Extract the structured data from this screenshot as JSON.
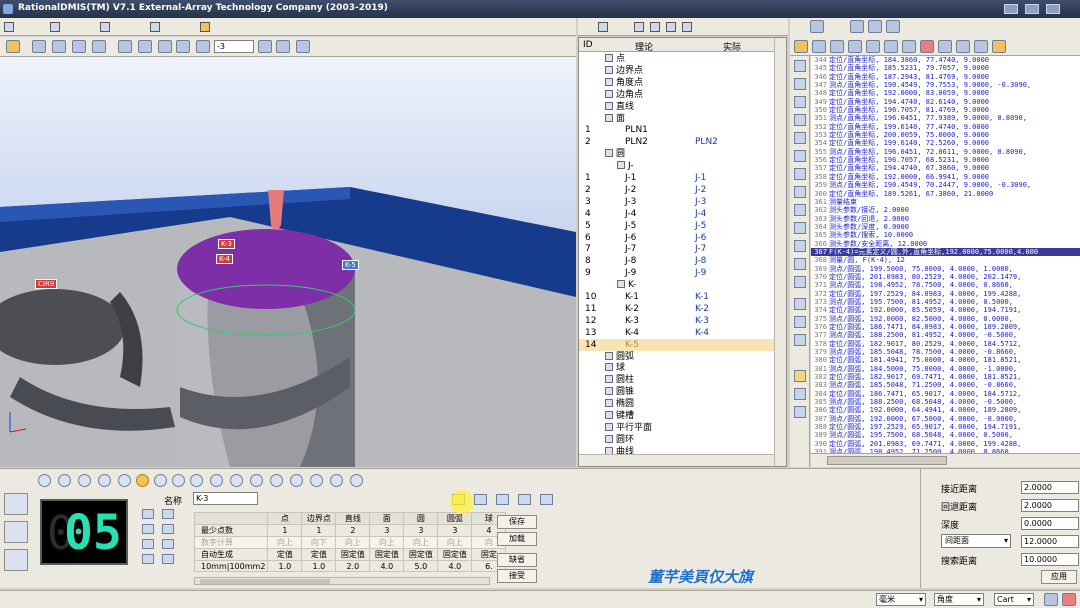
{
  "window": {
    "title": "RationalDMIS(TM) V7.1    External-Array Technology Company (2003-2019)"
  },
  "toolbar": {
    "value_input": "-3"
  },
  "viewport": {
    "labels": [
      {
        "text": "K-3",
        "color": "#d43a3a"
      },
      {
        "text": "K-4",
        "color": "#d43a3a"
      },
      {
        "text": "K-5",
        "color": "#3a7ad4"
      },
      {
        "text": "CIR9",
        "color": "#d43a3a"
      }
    ]
  },
  "tree": {
    "headers": {
      "id": "ID",
      "theory": "理论",
      "actual": "实际"
    },
    "rows": [
      {
        "id": "",
        "name": "点",
        "actual": ""
      },
      {
        "id": "",
        "name": "边界点",
        "actual": ""
      },
      {
        "id": "",
        "name": "角度点",
        "actual": ""
      },
      {
        "id": "",
        "name": "边角点",
        "actual": ""
      },
      {
        "id": "",
        "name": "直线",
        "actual": ""
      },
      {
        "id": "",
        "name": "面",
        "actual": ""
      },
      {
        "id": "1",
        "name": "PLN1",
        "actual": ""
      },
      {
        "id": "2",
        "name": "PLN2",
        "actual": "PLN2"
      },
      {
        "id": "",
        "name": "圆",
        "actual": ""
      },
      {
        "id": "",
        "name": "J-",
        "actual": ""
      },
      {
        "id": "1",
        "name": "J-1",
        "actual": "J-1"
      },
      {
        "id": "2",
        "name": "J-2",
        "actual": "J-2"
      },
      {
        "id": "3",
        "name": "J-3",
        "actual": "J-3"
      },
      {
        "id": "4",
        "name": "J-4",
        "actual": "J-4"
      },
      {
        "id": "5",
        "name": "J-5",
        "actual": "J-5"
      },
      {
        "id": "6",
        "name": "J-6",
        "actual": "J-6"
      },
      {
        "id": "7",
        "name": "J-7",
        "actual": "J-7"
      },
      {
        "id": "8",
        "name": "J-8",
        "actual": "J-8"
      },
      {
        "id": "9",
        "name": "J-9",
        "actual": "J-9"
      },
      {
        "id": "",
        "name": "K-",
        "actual": ""
      },
      {
        "id": "10",
        "name": "K-1",
        "actual": "K-1"
      },
      {
        "id": "11",
        "name": "K-2",
        "actual": "K-2"
      },
      {
        "id": "12",
        "name": "K-3",
        "actual": "K-3"
      },
      {
        "id": "13",
        "name": "K-4",
        "actual": "K-4"
      },
      {
        "id": "14",
        "name": "K-5",
        "actual": ""
      },
      {
        "id": "",
        "name": "圆弧",
        "actual": ""
      },
      {
        "id": "",
        "name": "球",
        "actual": ""
      },
      {
        "id": "",
        "name": "圆柱",
        "actual": ""
      },
      {
        "id": "",
        "name": "圆锥",
        "actual": ""
      },
      {
        "id": "",
        "name": "椭圆",
        "actual": ""
      },
      {
        "id": "",
        "name": "键槽",
        "actual": ""
      },
      {
        "id": "",
        "name": "平行平面",
        "actual": ""
      },
      {
        "id": "",
        "name": "圆环",
        "actual": ""
      },
      {
        "id": "",
        "name": "曲线",
        "actual": ""
      }
    ]
  },
  "program": {
    "lines": [
      {
        "num": "344",
        "text": "定位/直角坐标,   184.3860, 77.4740,   9.0000"
      },
      {
        "num": "345",
        "text": "定位/直角坐标,   185.5231, 79.7057,   9.0000"
      },
      {
        "num": "346",
        "text": "定位/直角坐标,   187.2943, 81.4769,   9.0000"
      },
      {
        "num": "347",
        "text": "测点/直角坐标,  190.4549, 79.7553,   9.0000, -0.3090,"
      },
      {
        "num": "348",
        "text": "定位/直角坐标,   192.0000, 83.0059,   9.0000"
      },
      {
        "num": "349",
        "text": "定位/直角坐标,   194.4740, 82.6140,   9.0000"
      },
      {
        "num": "350",
        "text": "定位/直角坐标,   196.7057, 81.4769,   9.0000"
      },
      {
        "num": "351",
        "text": "测点/直角坐标,  196.0451, 77.9389,   9.0000,  0.8090,"
      },
      {
        "num": "352",
        "text": "定位/直角坐标,   199.6140, 77.4740,   9.0000"
      },
      {
        "num": "353",
        "text": "定位/直角坐标,   200.0059, 75.0000,   9.0000"
      },
      {
        "num": "354",
        "text": "定位/直角坐标,   199.6140, 72.5260,   9.0000"
      },
      {
        "num": "355",
        "text": "测点/直角坐标,  196.0451, 72.0611,   9.0000,  0.8090,"
      },
      {
        "num": "356",
        "text": "定位/直角坐标,   196.7057, 68.5231,   9.0000"
      },
      {
        "num": "357",
        "text": "定位/直角坐标,   194.4740, 67.3860,   9.0000"
      },
      {
        "num": "358",
        "text": "定位/直角坐标,   192.0000, 66.9941,   9.0000"
      },
      {
        "num": "359",
        "text": "测点/直角坐标,  190.4549, 70.2447,   9.0000, -0.3090,"
      },
      {
        "num": "360",
        "text": "定位/直角坐标,   189.5261, 67.3860, 21.0000"
      },
      {
        "num": "361",
        "text": "测量结束"
      },
      {
        "num": "362",
        "text": "测头参数/接近, 2.0000"
      },
      {
        "num": "363",
        "text": "测头参数/回退, 2.0000"
      },
      {
        "num": "364",
        "text": "测头参数/深度, 0.0000"
      },
      {
        "num": "365",
        "text": "测头参数/搜索, 10.0000"
      },
      {
        "num": "366",
        "text": "测头参数/安全距离, 12.0000"
      },
      {
        "num": "367",
        "text": "F(K-4)=元素定义/圆,外,直角坐标,192.0000,75.0000,4.000"
      },
      {
        "num": "368",
        "text": "测量/圆, F(K-4), 12"
      },
      {
        "num": "369",
        "text": "测点/圆弧,   199.5000, 75.0000, 4.0000,  1.0000,"
      },
      {
        "num": "370",
        "text": "定位/圆弧,   201.0983, 80.2529, 4.0000, 202.1479,"
      },
      {
        "num": "371",
        "text": "测点/圆弧,   198.4952, 78.7500, 4.0000,  0.8660,"
      },
      {
        "num": "372",
        "text": "定位/圆弧,   197.2529, 84.0983, 4.0000, 199.4288,"
      },
      {
        "num": "373",
        "text": "测点/圆弧,   195.7500, 81.4952, 4.0000,  0.5000,"
      },
      {
        "num": "374",
        "text": "定位/圆弧,   192.0000, 85.5059, 4.0000, 194.7191,"
      },
      {
        "num": "375",
        "text": "测点/圆弧,   192.0000, 82.5000, 4.0000,  0.0000,"
      },
      {
        "num": "376",
        "text": "定位/圆弧,   186.7471, 84.0983, 4.0000, 189.2809,"
      },
      {
        "num": "377",
        "text": "测点/圆弧,   188.2500, 81.4952, 4.0000, -0.5000,"
      },
      {
        "num": "378",
        "text": "定位/圆弧,   182.9017, 80.2529, 4.0000, 184.5712,"
      },
      {
        "num": "379",
        "text": "测点/圆弧,   185.5048, 78.7500, 4.0000, -0.8660,"
      },
      {
        "num": "380",
        "text": "定位/圆弧,   181.4941, 75.0000, 4.0000, 181.8521,"
      },
      {
        "num": "381",
        "text": "测点/圆弧,   184.5000, 75.0000, 4.0000, -1.0000,"
      },
      {
        "num": "382",
        "text": "定位/圆弧,   182.9017, 69.7471, 4.0000, 181.8521,"
      },
      {
        "num": "383",
        "text": "测点/圆弧,   185.5048, 71.2500, 4.0000, -0.8660,"
      },
      {
        "num": "384",
        "text": "定位/圆弧,   186.7471, 65.9017, 4.0000, 184.5712,"
      },
      {
        "num": "385",
        "text": "测点/圆弧,   188.2500, 68.5048, 4.0000, -0.5000,"
      },
      {
        "num": "386",
        "text": "定位/圆弧,   192.0000, 64.4941, 4.0000, 189.2809,"
      },
      {
        "num": "387",
        "text": "测点/圆弧,   192.0000, 67.5000, 4.0000, -0.0000,"
      },
      {
        "num": "388",
        "text": "定位/圆弧,   197.2529, 65.9017, 4.0000, 194.7191,"
      },
      {
        "num": "389",
        "text": "测点/圆弧,   195.7500, 68.5048, 4.0000,  0.5000,"
      },
      {
        "num": "390",
        "text": "定位/圆弧,   201.0983, 69.7471, 4.0000, 199.4288,"
      },
      {
        "num": "391",
        "text": "测点/圆弧,   198.4952, 71.2500, 4.0000,  0.8660,"
      },
      {
        "num": "392",
        "text": "测量结束"
      },
      {
        "num": "393",
        "text": "F(K-5)=元素定义/圆,外,直角坐标,185.0000,28.0000,27.00"
      },
      {
        "num": "394",
        "text": ""
      }
    ]
  },
  "feature_panel": {
    "counter": "05",
    "counter_shadow": "0",
    "name_label": "名称",
    "name_value": "K-3",
    "table": {
      "headers": [
        "",
        "点",
        "边界点",
        "直线",
        "面",
        "圆",
        "圆弧",
        "球"
      ],
      "rows": [
        [
          "最少点数",
          "1",
          "1",
          "2",
          "3",
          "3",
          "3",
          "4"
        ],
        [
          "数字计算",
          "向上",
          "向下",
          "向上",
          "向上",
          "向上",
          "向上",
          "向"
        ],
        [
          "自动生成",
          "定值",
          "定值",
          "固定值",
          "固定值",
          "固定值",
          "固定值",
          "固定"
        ],
        [
          "10mm|100mm2",
          "1.0",
          "1.0",
          "2.0",
          "4.0",
          "5.0",
          "4.0",
          "6."
        ]
      ]
    },
    "buttons": {
      "save": "保存",
      "load": "加载",
      "default": "缺省",
      "accept": "接受"
    }
  },
  "probe_form": {
    "approach_label": "接近距离",
    "approach_value": "2.0000",
    "retract_label": "回退距离",
    "retract_value": "2.0000",
    "depth_label": "深度",
    "depth_value": "0.0000",
    "clearance_select": "间距面",
    "clearance_value": "12.0000",
    "search_label": "搜索距离",
    "search_value": "10.0000",
    "apply_label": "应用"
  },
  "statusbar": {
    "unit": "毫米",
    "angle": "角度",
    "coord": "Cart"
  },
  "watermark": "董芊美頁仅大旗"
}
